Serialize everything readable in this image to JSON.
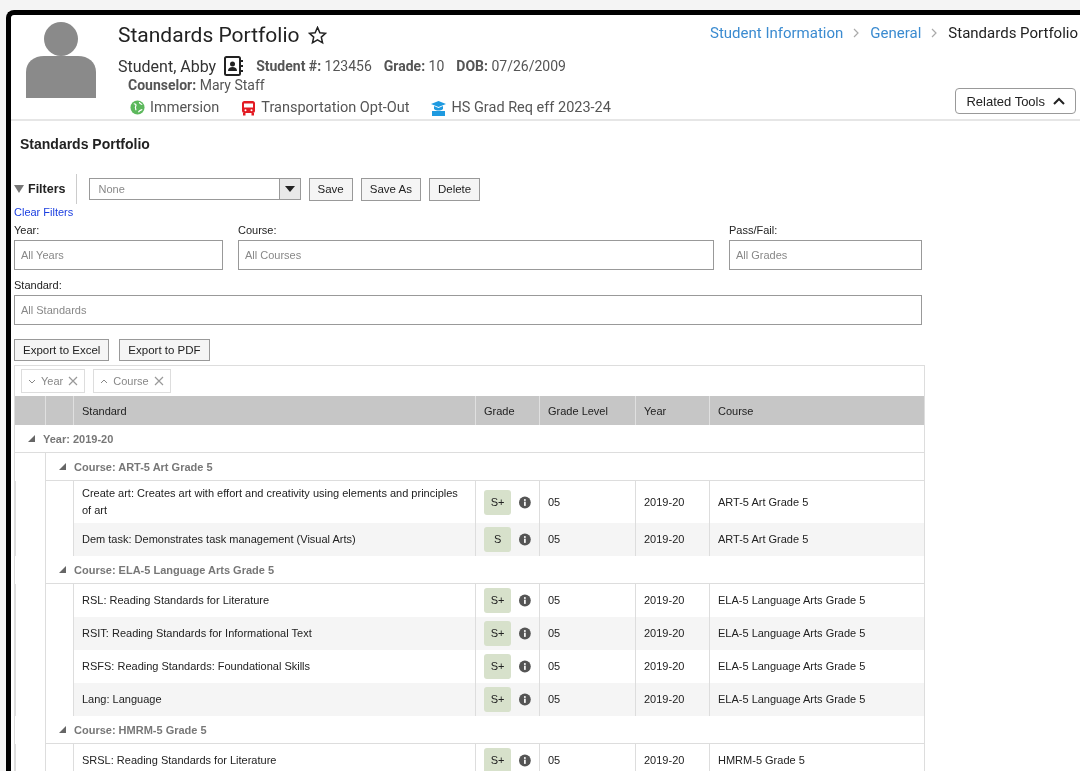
{
  "header": {
    "title": "Standards Portfolio",
    "favorite": false,
    "breadcrumb": [
      {
        "label": "Student Information",
        "kind": "link"
      },
      {
        "label": "General",
        "kind": "link"
      },
      {
        "label": "Standards Portfolio",
        "kind": "current"
      }
    ],
    "student_name": "Student, Abby",
    "fields": [
      "**Student #:** 123456",
      "**Grade:** 10",
      "**DOB:** 07/26/2009"
    ],
    "counselor": "**Counselor:** Mary Staff",
    "flags": [
      {
        "label": "Immersion",
        "kind": "globe",
        "color": "#5cb85c"
      },
      {
        "label": "Transportation Opt-Out",
        "kind": "bus",
        "color": "#e31b23"
      },
      {
        "label": "HS Grad Req eff 2023-24",
        "kind": "graduate",
        "color": "#1e9ae0"
      }
    ],
    "related_tools_button": {
      "label": "Related Tools",
      "expanded": true
    }
  },
  "section_title": "Standards Portfolio",
  "filters": {
    "label": "Filters",
    "expanded": true,
    "saved_filter": {
      "value": "None"
    },
    "buttons": [
      "Save",
      "Save As",
      "Delete"
    ],
    "clear_link": "Clear Filters",
    "fields": [
      {
        "label": "Year:",
        "placeholder": "All Years"
      },
      {
        "label": "Course:",
        "placeholder": "All Courses"
      },
      {
        "label": "Pass/Fail:",
        "placeholder": "All Grades"
      },
      {
        "label": "Standard:",
        "placeholder": "All Standards"
      }
    ]
  },
  "export_buttons": [
    "Export to Excel",
    "Export to PDF"
  ],
  "group_chips": [
    {
      "label": "Year",
      "ascending": false
    },
    {
      "label": "Course",
      "ascending": true
    }
  ],
  "table": {
    "columns": [
      "Standard",
      "Grade",
      "Grade Level",
      "Year",
      "Course"
    ],
    "groups": [
      {
        "label": "Year: 2019-20",
        "expanded": true,
        "children": [
          {
            "label": "Course: ART-5 Art Grade 5",
            "expanded": true,
            "rows": [
              {
                "standard": "Create art: Creates art with effort and creativity using elements and principles of art",
                "grade": "S+",
                "grade_level": "05",
                "year": "2019-20",
                "course": "ART-5 Art Grade 5"
              },
              {
                "standard": "Dem task: Demonstrates task management (Visual Arts)",
                "grade": "S",
                "grade_level": "05",
                "year": "2019-20",
                "course": "ART-5 Art Grade 5"
              }
            ]
          },
          {
            "label": "Course: ELA-5 Language Arts Grade 5",
            "expanded": true,
            "rows": [
              {
                "standard": "RSL: Reading Standards for Literature",
                "grade": "S+",
                "grade_level": "05",
                "year": "2019-20",
                "course": "ELA-5 Language Arts Grade 5"
              },
              {
                "standard": "RSIT: Reading Standards for Informational Text",
                "grade": "S+",
                "grade_level": "05",
                "year": "2019-20",
                "course": "ELA-5 Language Arts Grade 5"
              },
              {
                "standard": "RSFS: Reading Standards: Foundational Skills",
                "grade": "S+",
                "grade_level": "05",
                "year": "2019-20",
                "course": "ELA-5 Language Arts Grade 5"
              },
              {
                "standard": "Lang: Language",
                "grade": "S+",
                "grade_level": "05",
                "year": "2019-20",
                "course": "ELA-5 Language Arts Grade 5"
              }
            ]
          },
          {
            "label": "Course: HMRM-5 Grade 5",
            "expanded": true,
            "rows": [
              {
                "standard": "SRSL: Reading Standards for Literature",
                "grade": "S+",
                "grade_level": "05",
                "year": "2019-20",
                "course": "HMRM-5 Grade 5"
              }
            ]
          }
        ]
      }
    ]
  }
}
